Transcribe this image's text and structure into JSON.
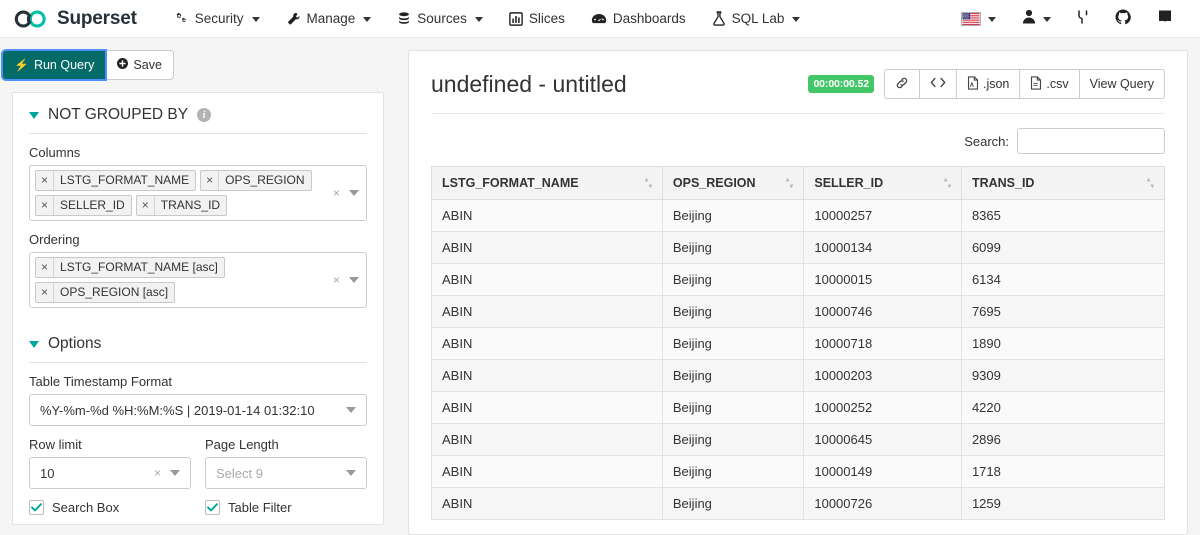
{
  "navbar": {
    "brand": "Superset",
    "items": [
      {
        "label": "Security",
        "icon": "gears-icon",
        "has_caret": true
      },
      {
        "label": "Manage",
        "icon": "wrench-icon",
        "has_caret": true
      },
      {
        "label": "Sources",
        "icon": "database-icon",
        "has_caret": true
      },
      {
        "label": "Slices",
        "icon": "bar-chart-icon",
        "has_caret": false
      },
      {
        "label": "Dashboards",
        "icon": "dashboard-icon",
        "has_caret": false
      },
      {
        "label": "SQL Lab",
        "icon": "flask-icon",
        "has_caret": true
      }
    ],
    "right_items": [
      {
        "icon": "us-flag-icon",
        "has_caret": true
      },
      {
        "icon": "user-icon",
        "has_caret": true
      },
      {
        "icon": "branch-icon",
        "has_caret": false
      },
      {
        "icon": "github-icon",
        "has_caret": false
      },
      {
        "icon": "book-icon",
        "has_caret": false
      }
    ]
  },
  "toolbar": {
    "run_query_label": "Run Query",
    "save_label": "Save"
  },
  "control_panel": {
    "sections": [
      {
        "title": "NOT GROUPED BY",
        "has_info": true,
        "expanded": true
      },
      {
        "title": "Options",
        "has_info": false,
        "expanded": true
      }
    ],
    "columns": {
      "label": "Columns",
      "tags": [
        "LSTG_FORMAT_NAME",
        "OPS_REGION",
        "SELLER_ID",
        "TRANS_ID"
      ]
    },
    "ordering": {
      "label": "Ordering",
      "tags": [
        "LSTG_FORMAT_NAME [asc]",
        "OPS_REGION [asc]"
      ]
    },
    "timestamp_format": {
      "label": "Table Timestamp Format",
      "value": "%Y-%m-%d %H:%M:%S | 2019-01-14 01:32:10"
    },
    "row_limit": {
      "label": "Row limit",
      "value": "10"
    },
    "page_length": {
      "label": "Page Length",
      "placeholder": "Select 9",
      "value": ""
    },
    "search_box_checkbox": {
      "label": "Search Box",
      "checked": true
    },
    "table_filter_checkbox": {
      "label": "Table Filter",
      "checked": true
    }
  },
  "chart": {
    "title": "undefined - untitled",
    "timer": "00:00:00.52",
    "actions": [
      {
        "label": "",
        "icon": "link-icon"
      },
      {
        "label": "",
        "icon": "code-icon"
      },
      {
        "label": ".json",
        "icon": "json-file-icon"
      },
      {
        "label": ".csv",
        "icon": "csv-file-icon"
      },
      {
        "label": "View Query",
        "icon": ""
      }
    ],
    "search": {
      "label": "Search:",
      "value": "",
      "placeholder": ""
    }
  },
  "table_data": {
    "type": "table",
    "columns": [
      "LSTG_FORMAT_NAME",
      "OPS_REGION",
      "SELLER_ID",
      "TRANS_ID"
    ],
    "rows": [
      [
        "ABIN",
        "Beijing",
        "10000257",
        "8365"
      ],
      [
        "ABIN",
        "Beijing",
        "10000134",
        "6099"
      ],
      [
        "ABIN",
        "Beijing",
        "10000015",
        "6134"
      ],
      [
        "ABIN",
        "Beijing",
        "10000746",
        "7695"
      ],
      [
        "ABIN",
        "Beijing",
        "10000718",
        "1890"
      ],
      [
        "ABIN",
        "Beijing",
        "10000203",
        "9309"
      ],
      [
        "ABIN",
        "Beijing",
        "10000252",
        "4220"
      ],
      [
        "ABIN",
        "Beijing",
        "10000645",
        "2896"
      ],
      [
        "ABIN",
        "Beijing",
        "10000149",
        "1718"
      ],
      [
        "ABIN",
        "Beijing",
        "10000726",
        "1259"
      ]
    ]
  },
  "colors": {
    "primary": "#046b68",
    "accent_teal": "#00a699",
    "badge_green": "#44c767",
    "focus_blue": "#4d90fe"
  }
}
